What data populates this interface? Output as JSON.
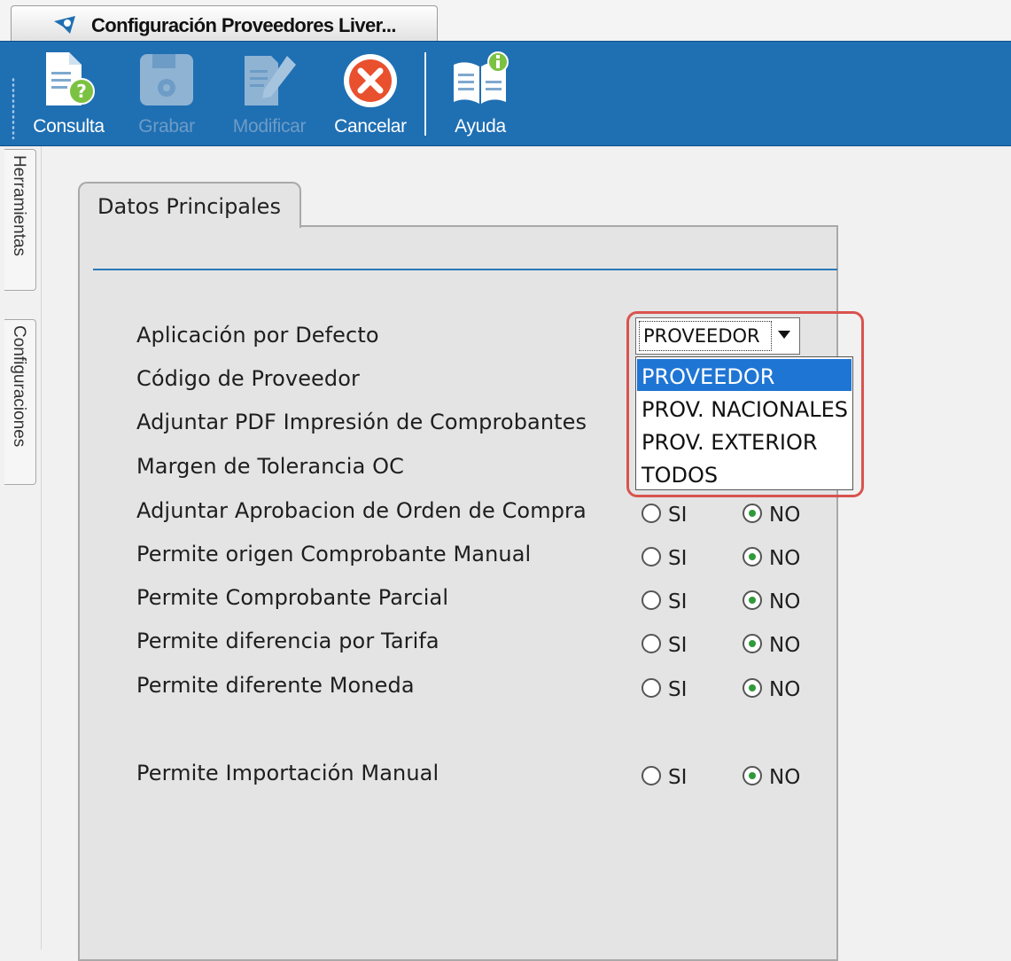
{
  "window_tab": {
    "title": "Configuración Proveedores Liver..."
  },
  "toolbar": {
    "buttons": [
      {
        "label": "Consulta",
        "icon": "document-question-icon",
        "enabled": true
      },
      {
        "label": "Grabar",
        "icon": "floppy-disk-icon",
        "enabled": false
      },
      {
        "label": "Modificar",
        "icon": "edit-document-pencil-icon",
        "enabled": false
      },
      {
        "label": "Cancelar",
        "icon": "cancel-x-circle-icon",
        "enabled": true
      },
      {
        "label": "Ayuda",
        "icon": "help-book-info-icon",
        "enabled": true
      }
    ]
  },
  "side_tabs": [
    {
      "label": "Herramientas"
    },
    {
      "label": "Configuraciones"
    }
  ],
  "panel": {
    "tab_label": "Datos Principales",
    "fields": [
      {
        "label": "Aplicación por Defecto"
      },
      {
        "label": "Código de Proveedor"
      },
      {
        "label": "Adjuntar PDF Impresión de Comprobantes"
      },
      {
        "label": "Margen de Tolerancia OC"
      },
      {
        "label": "Adjuntar Aprobacion de Orden de Compra",
        "si": "SI",
        "no": "NO",
        "selected": "NO"
      },
      {
        "label": "Permite origen Comprobante Manual",
        "si": "SI",
        "no": "NO",
        "selected": "NO"
      },
      {
        "label": "Permite Comprobante Parcial",
        "si": "SI",
        "no": "NO",
        "selected": "NO"
      },
      {
        "label": "Permite diferencia por Tarifa",
        "si": "SI",
        "no": "NO",
        "selected": "NO"
      },
      {
        "label": "Permite diferente Moneda",
        "si": "SI",
        "no": "NO",
        "selected": "NO"
      },
      {
        "label": "Permite Importación Manual",
        "si": "SI",
        "no": "NO",
        "selected": "NO"
      }
    ]
  },
  "dropdown": {
    "value": "PROVEEDOR",
    "options": [
      "PROVEEDOR",
      "PROV. NACIONALES",
      "PROV. EXTERIOR",
      "TODOS"
    ],
    "selected_index": 0,
    "highlight_color": "#d9534f"
  },
  "colors": {
    "toolbar_bg": "#1f6fb3",
    "selection_bg": "#1f75d4",
    "radio_checked": "#2f9a3a",
    "cancel_red": "#e8502e"
  }
}
